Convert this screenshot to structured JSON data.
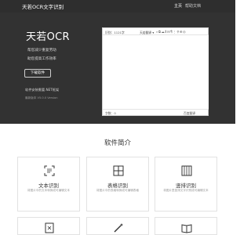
{
  "nav": {
    "brand": "天若OCR文字识别",
    "links": [
      "主页",
      "帮助文档"
    ]
  },
  "hero": {
    "title": "天若OCR",
    "lines": [
      "帮您减少重复劳动",
      "助您提高工作效率"
    ],
    "download_label": "下载软件",
    "note": "软件安装需要.NET框架",
    "version": "最新版本 V5.0.0 Version"
  },
  "app_window": {
    "title": "识别：1121字",
    "engine": "天若翻译 ▾",
    "tool_icons": [
      "magnifier-icon",
      "copy-icon",
      "cloud-icon",
      "format-icon",
      "fold-icon",
      "paragraph-icon",
      "split-icon",
      "pin-icon",
      "zoom-icon",
      "translate-icon"
    ],
    "word_count": "字数：0",
    "translate_label": "百度翻译"
  },
  "features": {
    "title": "软件简介",
    "cards": [
      {
        "title": "文本识别",
        "desc": "将图片中的文本转换成可编辑文本",
        "icon": "text-scan-icon"
      },
      {
        "title": "表格识别",
        "desc": "将图片中的表格转换成可编辑表格",
        "icon": "table-icon"
      },
      {
        "title": "竖排识别",
        "desc": "将图片里竖排文字识别成可编辑文本",
        "icon": "vertical-text-icon"
      },
      {
        "title": "",
        "desc": "",
        "icon": "formula-icon"
      },
      {
        "title": "",
        "desc": "",
        "icon": "magic-icon"
      },
      {
        "title": "",
        "desc": "",
        "icon": "book-icon"
      }
    ]
  }
}
